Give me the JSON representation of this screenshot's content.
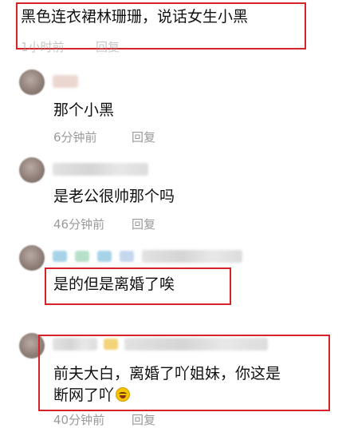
{
  "comments": [
    {
      "text": "黑色连衣裙林珊珊，说话女生小黑",
      "time": "1小时前",
      "reply_label": "回复"
    },
    {
      "text": "那个小黑",
      "time": "6分钟前",
      "reply_label": "回复"
    },
    {
      "text": "是老公很帅那个吗",
      "time": "46分钟前",
      "reply_label": "回复"
    },
    {
      "text": "是的但是离婚了唉",
      "time": "",
      "reply_label": ""
    },
    {
      "line1": "前夫大白，离婚了吖姐妹，你这是",
      "line2": "断网了吖",
      "emoji": "face-with-tears-of-joy-icon",
      "time": "40分钟前",
      "reply_label": "回复"
    }
  ],
  "colors": {
    "highlight": "#d6242b",
    "meta": "#9a9a9a",
    "text": "#111111"
  }
}
